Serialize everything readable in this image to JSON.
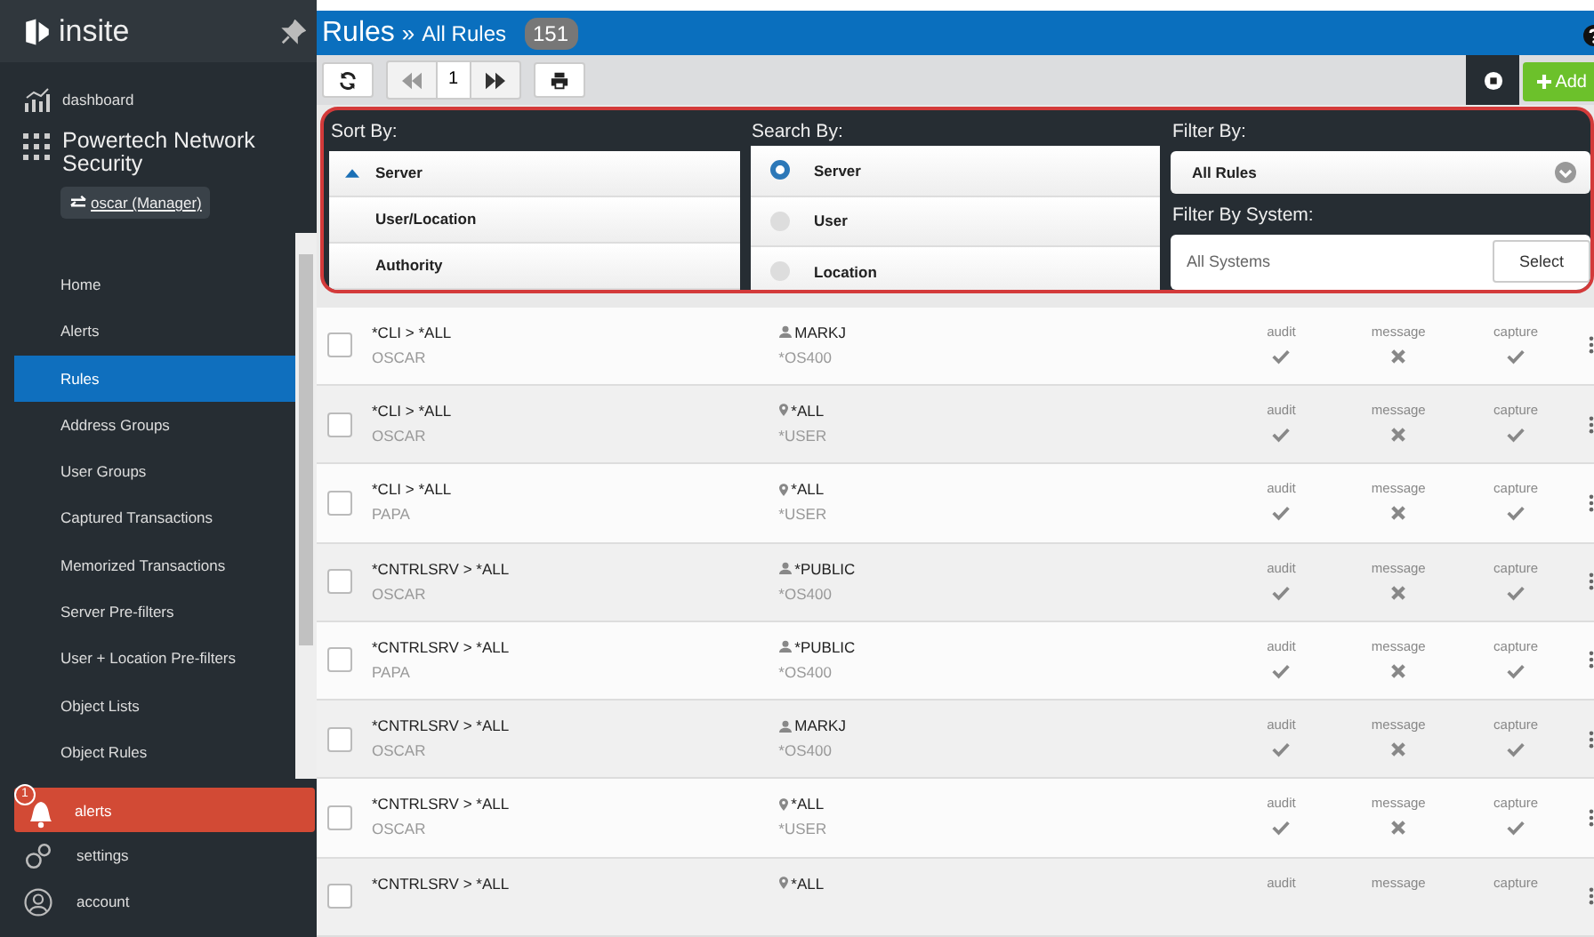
{
  "sidebar": {
    "logo": "insite",
    "dashboard": "dashboard",
    "product": "Powertech Network Security",
    "user_switch": "oscar (Manager)",
    "items": [
      {
        "label": "Home",
        "selected": false
      },
      {
        "label": "Alerts",
        "selected": false
      },
      {
        "label": "Rules",
        "selected": true
      },
      {
        "label": "Address Groups",
        "selected": false
      },
      {
        "label": "User Groups",
        "selected": false
      },
      {
        "label": "Captured Transactions",
        "selected": false
      },
      {
        "label": "Memorized Transactions",
        "selected": false
      },
      {
        "label": "Server Pre-filters",
        "selected": false
      },
      {
        "label": "User + Location Pre-filters",
        "selected": false
      },
      {
        "label": "Object Lists",
        "selected": false
      },
      {
        "label": "Object Rules",
        "selected": false
      }
    ],
    "alerts": {
      "label": "alerts",
      "count": "1"
    },
    "settings": "settings",
    "account": "account"
  },
  "header": {
    "title": "Rules",
    "separator": "»",
    "subtitle": "All Rules",
    "count": "151"
  },
  "toolbar": {
    "page": "1",
    "add": "Add"
  },
  "sort": {
    "label": "Sort By:",
    "options": [
      {
        "label": "Server",
        "selected": true
      },
      {
        "label": "User/Location",
        "selected": false
      },
      {
        "label": "Authority",
        "selected": false
      }
    ]
  },
  "search": {
    "label": "Search By:",
    "options": [
      {
        "label": "Server",
        "selected": true
      },
      {
        "label": "User",
        "selected": false
      },
      {
        "label": "Location",
        "selected": false
      }
    ]
  },
  "filter": {
    "label": "Filter By:",
    "value": "All Rules",
    "system_label": "Filter By System:",
    "system_value": "All Systems",
    "select": "Select"
  },
  "rows": [
    {
      "checked": false,
      "server": "*CLI > *ALL",
      "system": "OSCAR",
      "user": {
        "kind": "user",
        "name": "MARKJ",
        "profile": "*OS400"
      },
      "flags": [
        {
          "label": "audit",
          "on": true
        },
        {
          "label": "message",
          "on": false
        },
        {
          "label": "capture",
          "on": true
        }
      ]
    },
    {
      "checked": false,
      "server": "*CLI > *ALL",
      "system": "OSCAR",
      "user": {
        "kind": "location",
        "name": "*ALL",
        "profile": "*USER"
      },
      "flags": [
        {
          "label": "audit",
          "on": true
        },
        {
          "label": "message",
          "on": false
        },
        {
          "label": "capture",
          "on": true
        }
      ]
    },
    {
      "checked": false,
      "server": "*CLI > *ALL",
      "system": "PAPA",
      "user": {
        "kind": "location",
        "name": "*ALL",
        "profile": "*USER"
      },
      "flags": [
        {
          "label": "audit",
          "on": true
        },
        {
          "label": "message",
          "on": false
        },
        {
          "label": "capture",
          "on": true
        }
      ]
    },
    {
      "checked": false,
      "server": "*CNTRLSRV > *ALL",
      "system": "OSCAR",
      "user": {
        "kind": "user",
        "name": "*PUBLIC",
        "profile": "*OS400"
      },
      "flags": [
        {
          "label": "audit",
          "on": true
        },
        {
          "label": "message",
          "on": false
        },
        {
          "label": "capture",
          "on": true
        }
      ]
    },
    {
      "checked": false,
      "server": "*CNTRLSRV > *ALL",
      "system": "PAPA",
      "user": {
        "kind": "user",
        "name": "*PUBLIC",
        "profile": "*OS400"
      },
      "flags": [
        {
          "label": "audit",
          "on": true
        },
        {
          "label": "message",
          "on": false
        },
        {
          "label": "capture",
          "on": true
        }
      ]
    },
    {
      "checked": false,
      "server": "*CNTRLSRV > *ALL",
      "system": "OSCAR",
      "user": {
        "kind": "user",
        "name": "MARKJ",
        "profile": "*OS400"
      },
      "flags": [
        {
          "label": "audit",
          "on": true
        },
        {
          "label": "message",
          "on": false
        },
        {
          "label": "capture",
          "on": true
        }
      ]
    },
    {
      "checked": false,
      "server": "*CNTRLSRV > *ALL",
      "system": "OSCAR",
      "user": {
        "kind": "location",
        "name": "*ALL",
        "profile": "*USER"
      },
      "flags": [
        {
          "label": "audit",
          "on": true
        },
        {
          "label": "message",
          "on": false
        },
        {
          "label": "capture",
          "on": true
        }
      ]
    },
    {
      "checked": false,
      "server": "*CNTRLSRV > *ALL",
      "user": {
        "kind": "location",
        "name": "*ALL"
      },
      "flags": [
        {
          "label": "audit"
        },
        {
          "label": "message"
        },
        {
          "label": "capture"
        }
      ]
    }
  ]
}
